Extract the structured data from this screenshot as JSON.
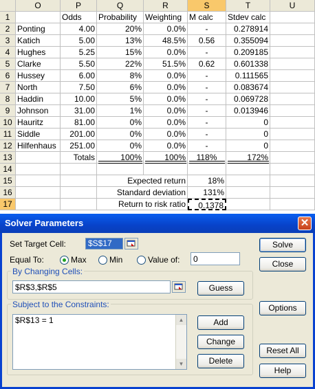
{
  "sheet": {
    "columns": [
      "O",
      "P",
      "Q",
      "R",
      "S",
      "T",
      "U"
    ],
    "rows": [
      {
        "n": "1",
        "cells": [
          "",
          "Odds",
          "Probability",
          "Weighting",
          "M calc",
          "Stdev calc",
          ""
        ]
      },
      {
        "n": "2",
        "cells": [
          "Ponting",
          "4.00",
          "20%",
          "0.0%",
          "-",
          "0.278914",
          ""
        ]
      },
      {
        "n": "3",
        "cells": [
          "Katich",
          "5.00",
          "13%",
          "48.5%",
          "0.56",
          "0.355094",
          ""
        ]
      },
      {
        "n": "4",
        "cells": [
          "Hughes",
          "5.25",
          "15%",
          "0.0%",
          "-",
          "0.209185",
          ""
        ]
      },
      {
        "n": "5",
        "cells": [
          "Clarke",
          "5.50",
          "22%",
          "51.5%",
          "0.62",
          "0.601338",
          ""
        ]
      },
      {
        "n": "6",
        "cells": [
          "Hussey",
          "6.00",
          "8%",
          "0.0%",
          "-",
          "0.111565",
          ""
        ]
      },
      {
        "n": "7",
        "cells": [
          "North",
          "7.50",
          "6%",
          "0.0%",
          "-",
          "0.083674",
          ""
        ]
      },
      {
        "n": "8",
        "cells": [
          "Haddin",
          "10.00",
          "5%",
          "0.0%",
          "-",
          "0.069728",
          ""
        ]
      },
      {
        "n": "9",
        "cells": [
          "Johnson",
          "31.00",
          "1%",
          "0.0%",
          "-",
          "0.013946",
          ""
        ]
      },
      {
        "n": "10",
        "cells": [
          "Hauritz",
          "81.00",
          "0%",
          "0.0%",
          "-",
          "0",
          ""
        ]
      },
      {
        "n": "11",
        "cells": [
          "Siddle",
          "201.00",
          "0%",
          "0.0%",
          "-",
          "0",
          ""
        ]
      },
      {
        "n": "12",
        "cells": [
          "Hilfenhaus",
          "251.00",
          "0%",
          "0.0%",
          "-",
          "0",
          ""
        ]
      },
      {
        "n": "13",
        "cells": [
          "",
          "Totals",
          "100%",
          "100%",
          "118%",
          "172%",
          ""
        ]
      },
      {
        "n": "14",
        "cells": [
          "",
          "",
          "",
          "",
          "",
          "",
          ""
        ]
      },
      {
        "n": "15",
        "cells": [
          "",
          "",
          "Expected return",
          "",
          "18%",
          "",
          ""
        ]
      },
      {
        "n": "16",
        "cells": [
          "",
          "",
          "Standard deviation",
          "",
          "131%",
          "",
          ""
        ]
      },
      {
        "n": "17",
        "cells": [
          "",
          "",
          "Return to risk ratio",
          "",
          "0.1378",
          "",
          ""
        ]
      }
    ]
  },
  "dialog": {
    "title": "Solver Parameters",
    "set_target_label": "Set Target Cell:",
    "target_value": "$S$17",
    "equal_to_label": "Equal To:",
    "radio_max": "Max",
    "radio_min": "Min",
    "radio_value_of": "Value of:",
    "value_of_input": "0",
    "changing_cells_label": "By Changing Cells:",
    "changing_cells_value": "$R$3,$R$5",
    "guess_label": "Guess",
    "constraints_label": "Subject to the Constraints:",
    "constraints": [
      "$R$13 = 1"
    ],
    "add_label": "Add",
    "change_label": "Change",
    "delete_label": "Delete",
    "solve_label": "Solve",
    "close_label": "Close",
    "options_label": "Options",
    "reset_label": "Reset All",
    "help_label": "Help",
    "accent": "#0a5fef"
  }
}
